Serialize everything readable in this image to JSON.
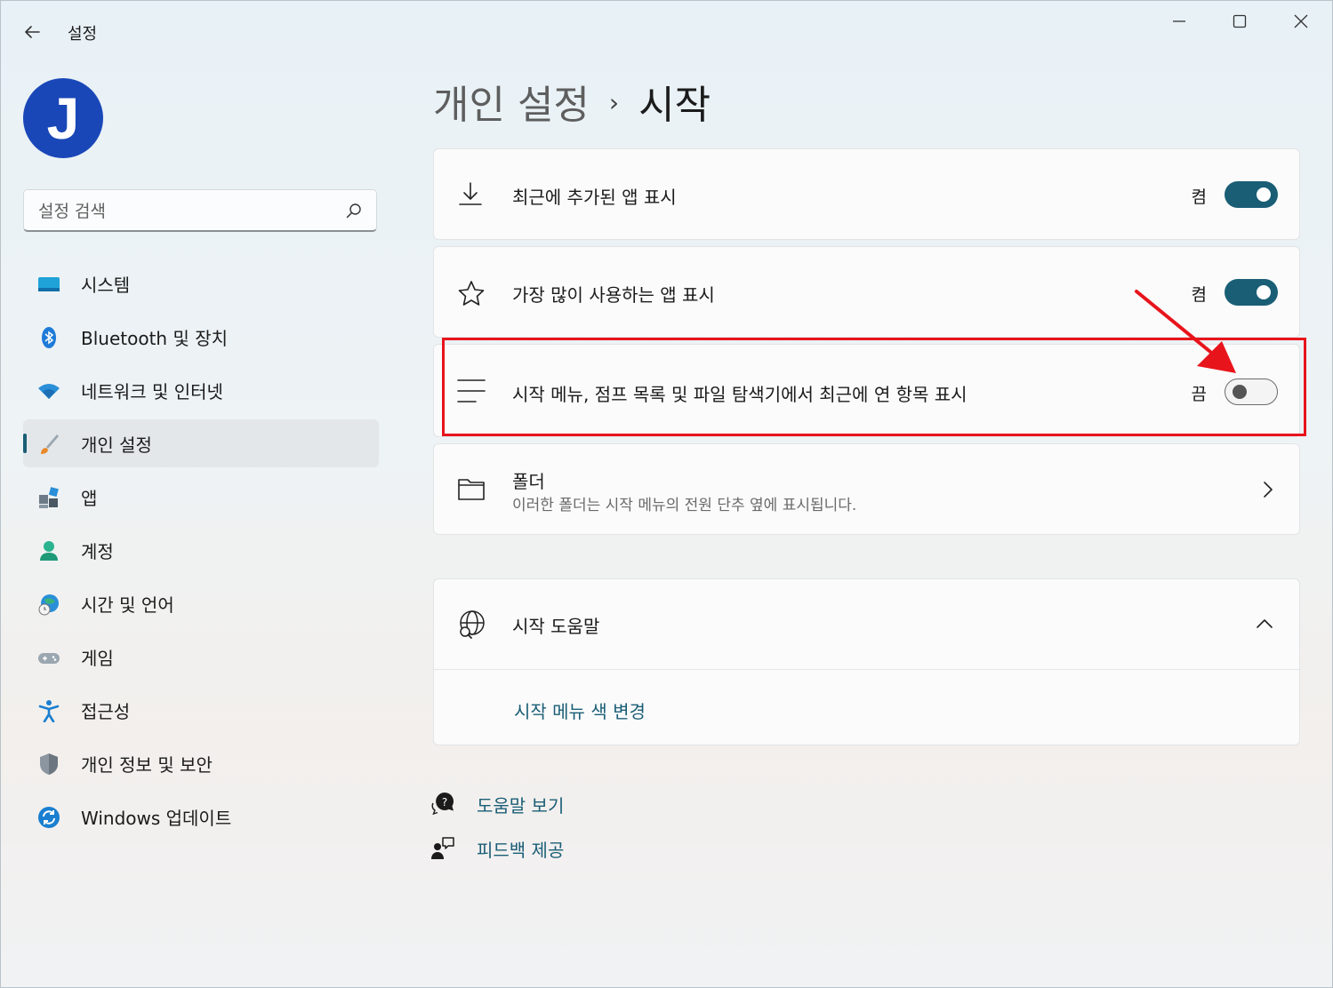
{
  "app": {
    "title": "설정"
  },
  "user": {
    "avatar_letter": "J"
  },
  "search": {
    "placeholder": "설정 검색"
  },
  "sidebar": {
    "items": [
      {
        "label": "시스템",
        "icon": "system-icon",
        "active": false
      },
      {
        "label": "Bluetooth 및 장치",
        "icon": "bluetooth-icon",
        "active": false
      },
      {
        "label": "네트워크 및 인터넷",
        "icon": "wifi-icon",
        "active": false
      },
      {
        "label": "개인 설정",
        "icon": "brush-icon",
        "active": true
      },
      {
        "label": "앱",
        "icon": "apps-icon",
        "active": false
      },
      {
        "label": "계정",
        "icon": "account-icon",
        "active": false
      },
      {
        "label": "시간 및 언어",
        "icon": "time-language-icon",
        "active": false
      },
      {
        "label": "게임",
        "icon": "gamepad-icon",
        "active": false
      },
      {
        "label": "접근성",
        "icon": "accessibility-icon",
        "active": false
      },
      {
        "label": "개인 정보 및 보안",
        "icon": "shield-icon",
        "active": false
      },
      {
        "label": "Windows 업데이트",
        "icon": "update-icon",
        "active": false
      }
    ]
  },
  "breadcrumb": {
    "parent": "개인 설정",
    "separator": "›",
    "current": "시작"
  },
  "settings": [
    {
      "title": "최근에 추가된 앱 표시",
      "state": "켬",
      "on": true,
      "icon": "download-icon"
    },
    {
      "title": "가장 많이 사용하는 앱 표시",
      "state": "켬",
      "on": true,
      "icon": "star-icon"
    },
    {
      "title": "시작 메뉴, 점프 목록 및 파일 탐색기에서 최근에 연 항목 표시",
      "state": "끔",
      "on": false,
      "icon": "list-icon"
    }
  ],
  "folders": {
    "title": "폴더",
    "subtitle": "이러한 폴더는 시작 메뉴의 전원 단추 옆에 표시됩니다.",
    "icon": "folder-icon"
  },
  "help_section": {
    "title": "시작 도움말",
    "link": "시작 메뉴 색 변경",
    "icon": "globe-search-icon"
  },
  "footer": {
    "get_help": "도움말 보기",
    "feedback": "피드백 제공"
  },
  "colors": {
    "accent": "#1a5e76",
    "highlight": "#e8141c"
  }
}
